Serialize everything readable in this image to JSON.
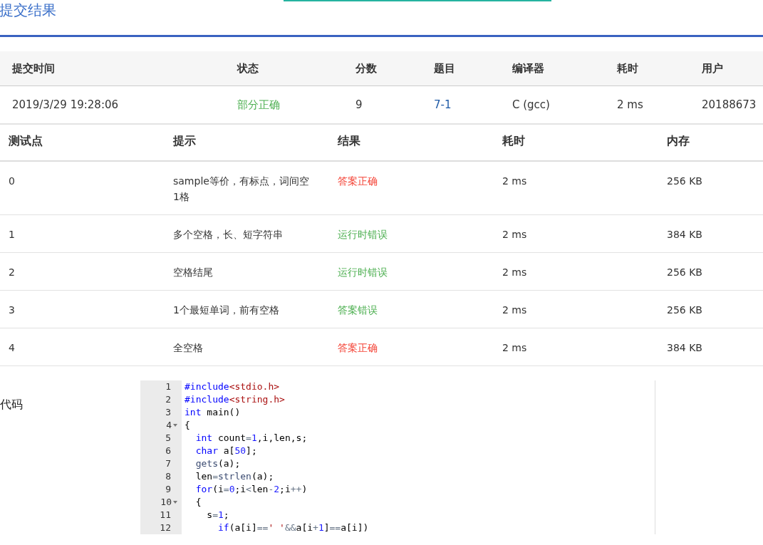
{
  "page_title": "提交结果",
  "summary": {
    "columns": [
      "提交时间",
      "状态",
      "分数",
      "题目",
      "编译器",
      "耗时",
      "用户"
    ],
    "row": [
      {
        "text": "2019/3/29 19:28:06",
        "kind": "plain"
      },
      {
        "text": "部分正确",
        "kind": "status",
        "color": "#4caf50"
      },
      {
        "text": "9",
        "kind": "plain"
      },
      {
        "text": "7-1",
        "kind": "link"
      },
      {
        "text": "C (gcc)",
        "kind": "plain"
      },
      {
        "text": "2 ms",
        "kind": "plain"
      },
      {
        "text": "20188673",
        "kind": "plain"
      }
    ]
  },
  "tests": {
    "columns": [
      "测试点",
      "提示",
      "结果",
      "耗时",
      "内存"
    ],
    "rows": [
      {
        "id": "0",
        "hint": "sample等价，有标点，词间空1格",
        "result": "答案正确",
        "color": "#f44336",
        "time": "2 ms",
        "memory": "256 KB"
      },
      {
        "id": "1",
        "hint": "多个空格，长、短字符串",
        "result": "运行时错误",
        "color": "#4caf50",
        "time": "2 ms",
        "memory": "384 KB"
      },
      {
        "id": "2",
        "hint": "空格结尾",
        "result": "运行时错误",
        "color": "#4caf50",
        "time": "2 ms",
        "memory": "256 KB"
      },
      {
        "id": "3",
        "hint": "1个最短单词，前有空格",
        "result": "答案错误",
        "color": "#4caf50",
        "time": "2 ms",
        "memory": "256 KB"
      },
      {
        "id": "4",
        "hint": "全空格",
        "result": "答案正确",
        "color": "#f44336",
        "time": "2 ms",
        "memory": "384 KB"
      }
    ]
  },
  "code": {
    "label": "代码",
    "lines": [
      {
        "number": "1",
        "fold": false,
        "tokens": [
          {
            "kind": "kw",
            "text": "#include"
          },
          {
            "kind": "str",
            "text": "<stdio.h>"
          }
        ]
      },
      {
        "number": "2",
        "fold": false,
        "tokens": [
          {
            "kind": "kw",
            "text": "#include"
          },
          {
            "kind": "str",
            "text": "<string.h>"
          }
        ]
      },
      {
        "number": "3",
        "fold": false,
        "tokens": [
          {
            "kind": "kw",
            "text": "int"
          },
          {
            "kind": "plain",
            "text": " main()"
          }
        ]
      },
      {
        "number": "4",
        "fold": true,
        "tokens": [
          {
            "kind": "plain",
            "text": "{"
          }
        ]
      },
      {
        "number": "5",
        "fold": false,
        "tokens": [
          {
            "kind": "kw",
            "text": "  int"
          },
          {
            "kind": "plain",
            "text": " count"
          },
          {
            "kind": "op",
            "text": "="
          },
          {
            "kind": "num",
            "text": "1"
          },
          {
            "kind": "plain",
            "text": ",i,len,s;"
          }
        ]
      },
      {
        "number": "6",
        "fold": false,
        "tokens": [
          {
            "kind": "kw",
            "text": "  char"
          },
          {
            "kind": "plain",
            "text": " a["
          },
          {
            "kind": "num",
            "text": "50"
          },
          {
            "kind": "plain",
            "text": "];"
          }
        ]
      },
      {
        "number": "7",
        "fold": false,
        "tokens": [
          {
            "kind": "fn",
            "text": "  gets"
          },
          {
            "kind": "plain",
            "text": "(a);"
          }
        ]
      },
      {
        "number": "8",
        "fold": false,
        "tokens": [
          {
            "kind": "plain",
            "text": "  len"
          },
          {
            "kind": "op",
            "text": "="
          },
          {
            "kind": "fn",
            "text": "strlen"
          },
          {
            "kind": "plain",
            "text": "(a);"
          }
        ]
      },
      {
        "number": "9",
        "fold": false,
        "tokens": [
          {
            "kind": "kw",
            "text": "  for"
          },
          {
            "kind": "plain",
            "text": "(i"
          },
          {
            "kind": "op",
            "text": "="
          },
          {
            "kind": "num",
            "text": "0"
          },
          {
            "kind": "plain",
            "text": ";i"
          },
          {
            "kind": "op",
            "text": "<"
          },
          {
            "kind": "plain",
            "text": "len"
          },
          {
            "kind": "op",
            "text": "-"
          },
          {
            "kind": "num",
            "text": "2"
          },
          {
            "kind": "plain",
            "text": ";i"
          },
          {
            "kind": "op",
            "text": "++"
          },
          {
            "kind": "plain",
            "text": ")"
          }
        ]
      },
      {
        "number": "10",
        "fold": true,
        "tokens": [
          {
            "kind": "plain",
            "text": "  {"
          }
        ]
      },
      {
        "number": "11",
        "fold": false,
        "tokens": [
          {
            "kind": "plain",
            "text": "    s"
          },
          {
            "kind": "op",
            "text": "="
          },
          {
            "kind": "num",
            "text": "1"
          },
          {
            "kind": "plain",
            "text": ";"
          }
        ]
      },
      {
        "number": "12",
        "fold": false,
        "tokens": [
          {
            "kind": "kw",
            "text": "      if"
          },
          {
            "kind": "plain",
            "text": "(a[i]"
          },
          {
            "kind": "op",
            "text": "=="
          },
          {
            "kind": "str",
            "text": "' '"
          },
          {
            "kind": "op",
            "text": "&&"
          },
          {
            "kind": "plain",
            "text": "a[i"
          },
          {
            "kind": "op",
            "text": "+"
          },
          {
            "kind": "num",
            "text": "1"
          },
          {
            "kind": "plain",
            "text": "]"
          },
          {
            "kind": "op",
            "text": "=="
          },
          {
            "kind": "plain",
            "text": "a[i])"
          }
        ]
      }
    ]
  }
}
